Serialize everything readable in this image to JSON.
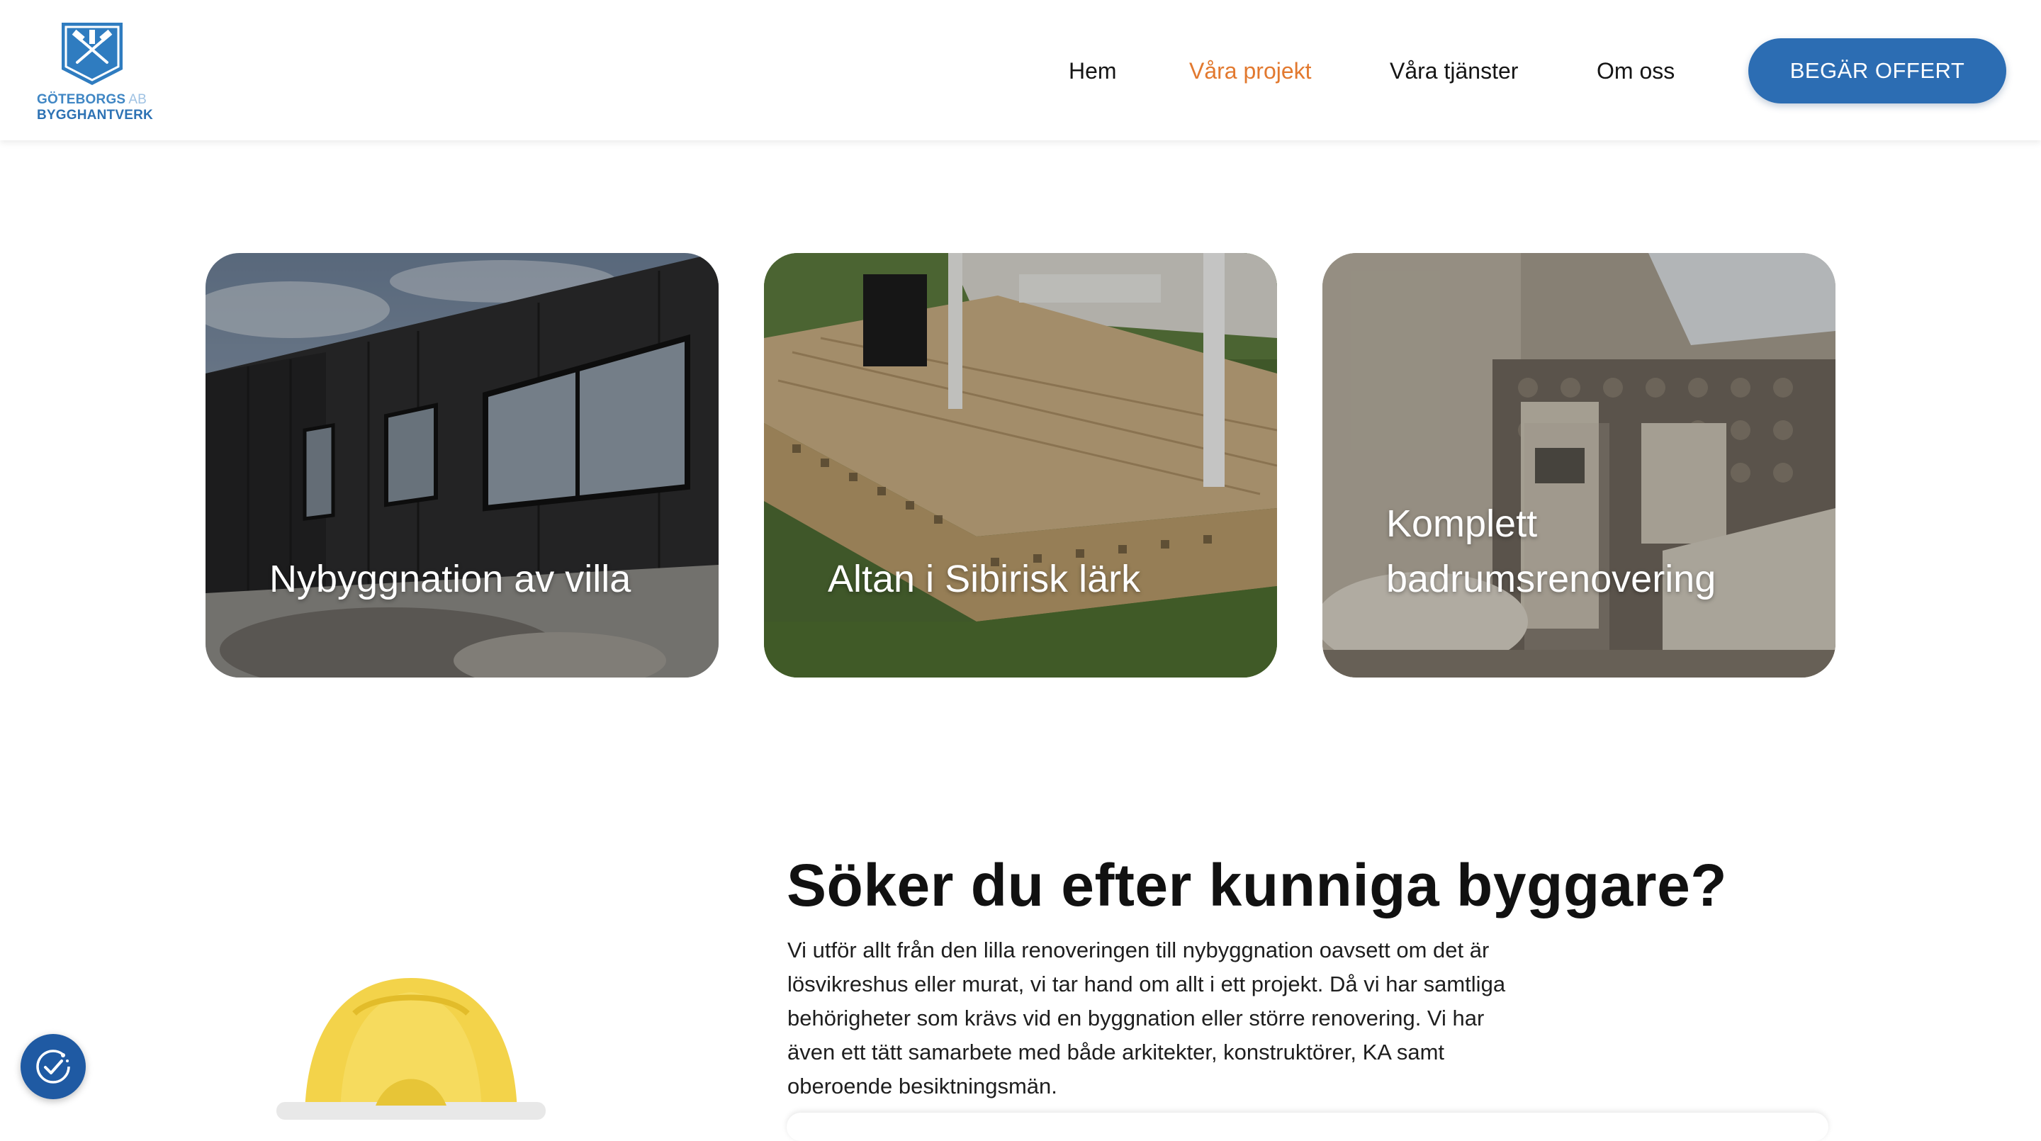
{
  "header": {
    "logo": {
      "line1": "GÖTEBORGS",
      "ab": "AB",
      "line2": "BYGGHANTVERK"
    },
    "nav": [
      {
        "label": "Hem",
        "active": false
      },
      {
        "label": "Våra projekt",
        "active": true
      },
      {
        "label": "Våra tjänster",
        "active": false
      },
      {
        "label": "Om oss",
        "active": false
      }
    ],
    "cta_label": "BEGÄR OFFERT"
  },
  "projects": [
    {
      "title": "Nybyggnation av villa"
    },
    {
      "title": "Altan i Sibirisk lärk"
    },
    {
      "title": "Komplett badrumsrenovering"
    }
  ],
  "intro": {
    "heading": "Söker du efter kunniga byggare?",
    "body": "Vi utför allt från den lilla renoveringen till nybyggnation oavsett om det är lösvikreshus eller murat, vi tar hand om allt i ett projekt. Då vi har samtliga behörigheter som krävs vid en byggnation eller större renovering. Vi har även ett tätt samarbete med både arkitekter, konstruktörer, KA samt oberoende besiktningsmän."
  },
  "colors": {
    "accent": "#e2792f",
    "brand_blue": "#2c6db3",
    "text": "#111111"
  },
  "icons": {
    "cookie": "cookie-consent-icon",
    "logo": "hammer-crossed-tools-icon"
  }
}
